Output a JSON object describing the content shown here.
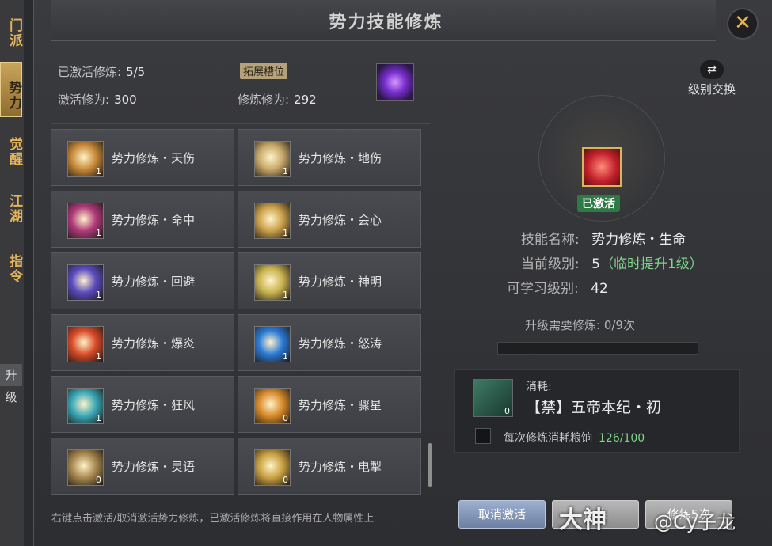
{
  "side_tabs": [
    "门派",
    "势力",
    "觉醒",
    "江湖",
    "指令"
  ],
  "side_sub": "升级",
  "title": "势力技能修炼",
  "close": "✕",
  "stats": {
    "activated_label": "已激活修炼:",
    "activated_value": "5/5",
    "expand_label": "拓展槽位",
    "activate_power_label": "激活修为:",
    "activate_power_value": "300",
    "train_power_label": "修炼修为:",
    "train_power_value": "292"
  },
  "skills": [
    {
      "name": "势力修炼・天伤",
      "level": "1",
      "color": "#c98a3a"
    },
    {
      "name": "势力修炼・地伤",
      "level": "1",
      "color": "#c7a86a"
    },
    {
      "name": "势力修炼・命中",
      "level": "1",
      "color": "#b03a7a"
    },
    {
      "name": "势力修炼・会心",
      "level": "1",
      "color": "#caa04a"
    },
    {
      "name": "势力修炼・回避",
      "level": "1",
      "color": "#5a4ac0"
    },
    {
      "name": "势力修炼・神明",
      "level": "1",
      "color": "#c8b250"
    },
    {
      "name": "势力修炼・爆炎",
      "level": "1",
      "color": "#d84a28"
    },
    {
      "name": "势力修炼・怒涛",
      "level": "1",
      "color": "#2a7ad8"
    },
    {
      "name": "势力修炼・狂风",
      "level": "1",
      "color": "#3aa8b8"
    },
    {
      "name": "势力修炼・骤星",
      "level": "0",
      "color": "#d88a2a"
    },
    {
      "name": "势力修炼・灵语",
      "level": "0",
      "color": "#a88850"
    },
    {
      "name": "势力修炼・电掣",
      "level": "0",
      "color": "#c8a040"
    }
  ],
  "hint": "右键点击激活/取消激活势力修炼，已激活修炼将直接作用在人物属性上",
  "swap": {
    "icon": "swap-icon",
    "label": "级别交换"
  },
  "selected": {
    "status": "已激活",
    "name_label": "技能名称:",
    "name_value": "势力修炼・生命",
    "level_label": "当前级别:",
    "level_value": "5",
    "level_extra": "（临时提升1级）",
    "learn_label": "可学习级别:",
    "learn_value": "42",
    "upgrade_text": "升级需要修炼: 0/9次",
    "progress": 0
  },
  "consume": {
    "label": "消耗:",
    "item": "【禁】五帝本纪・初",
    "item_count": "0",
    "check_label": "每次修炼消耗粮饷",
    "check_value": "126/100"
  },
  "buttons": {
    "cancel": "取消激活",
    "train": "修炼",
    "train5": "修炼5次"
  },
  "watermark": {
    "logo": "大神",
    "user": "@Cy子龙"
  },
  "colors": {
    "gold": "#e2b45c",
    "green": "#7ed68a",
    "panel": "#3a3b3f"
  }
}
